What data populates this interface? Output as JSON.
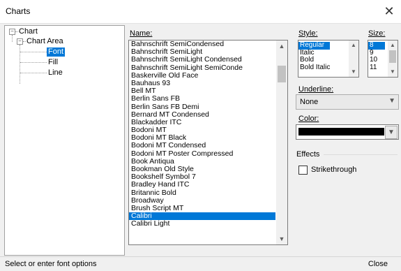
{
  "window": {
    "title": "Charts",
    "close_glyph": "✕"
  },
  "tree": {
    "root": "Chart",
    "child": "Chart Area",
    "leaves": [
      "Font",
      "Fill",
      "Line"
    ],
    "expander_glyph": "−"
  },
  "name": {
    "label": "Name:",
    "fonts": [
      "Bahnschrift SemiCondensed",
      "Bahnschrift SemiLight",
      "Bahnschrift SemiLight Condensed",
      "Bahnschrift SemiLight SemiConde",
      "Baskerville Old Face",
      "Bauhaus 93",
      "Bell MT",
      "Berlin Sans FB",
      "Berlin Sans FB Demi",
      "Bernard MT Condensed",
      "Blackadder ITC",
      "Bodoni MT",
      "Bodoni MT Black",
      "Bodoni MT Condensed",
      "Bodoni MT Poster Compressed",
      "Book Antiqua",
      "Bookman Old Style",
      "Bookshelf Symbol 7",
      "Bradley Hand ITC",
      "Britannic Bold",
      "Broadway",
      "Brush Script MT",
      "Calibri",
      "Calibri Light"
    ],
    "selected": "Calibri"
  },
  "style": {
    "label": "Style:",
    "options": [
      "Regular",
      "Italic",
      "Bold",
      "Bold Italic"
    ],
    "selected": "Regular"
  },
  "size": {
    "label": "Size:",
    "options": [
      "8",
      "9",
      "10",
      "11"
    ],
    "selected": "8"
  },
  "underline": {
    "label": "Underline:",
    "value": "None"
  },
  "color": {
    "label": "Color:",
    "value": "#000000"
  },
  "effects": {
    "label": "Effects",
    "strikethrough": "Strikethrough",
    "strikethrough_checked": false
  },
  "status": {
    "text": "Select or enter font options",
    "close_label": "Close"
  },
  "colors": {
    "selection": "#0078d7"
  }
}
